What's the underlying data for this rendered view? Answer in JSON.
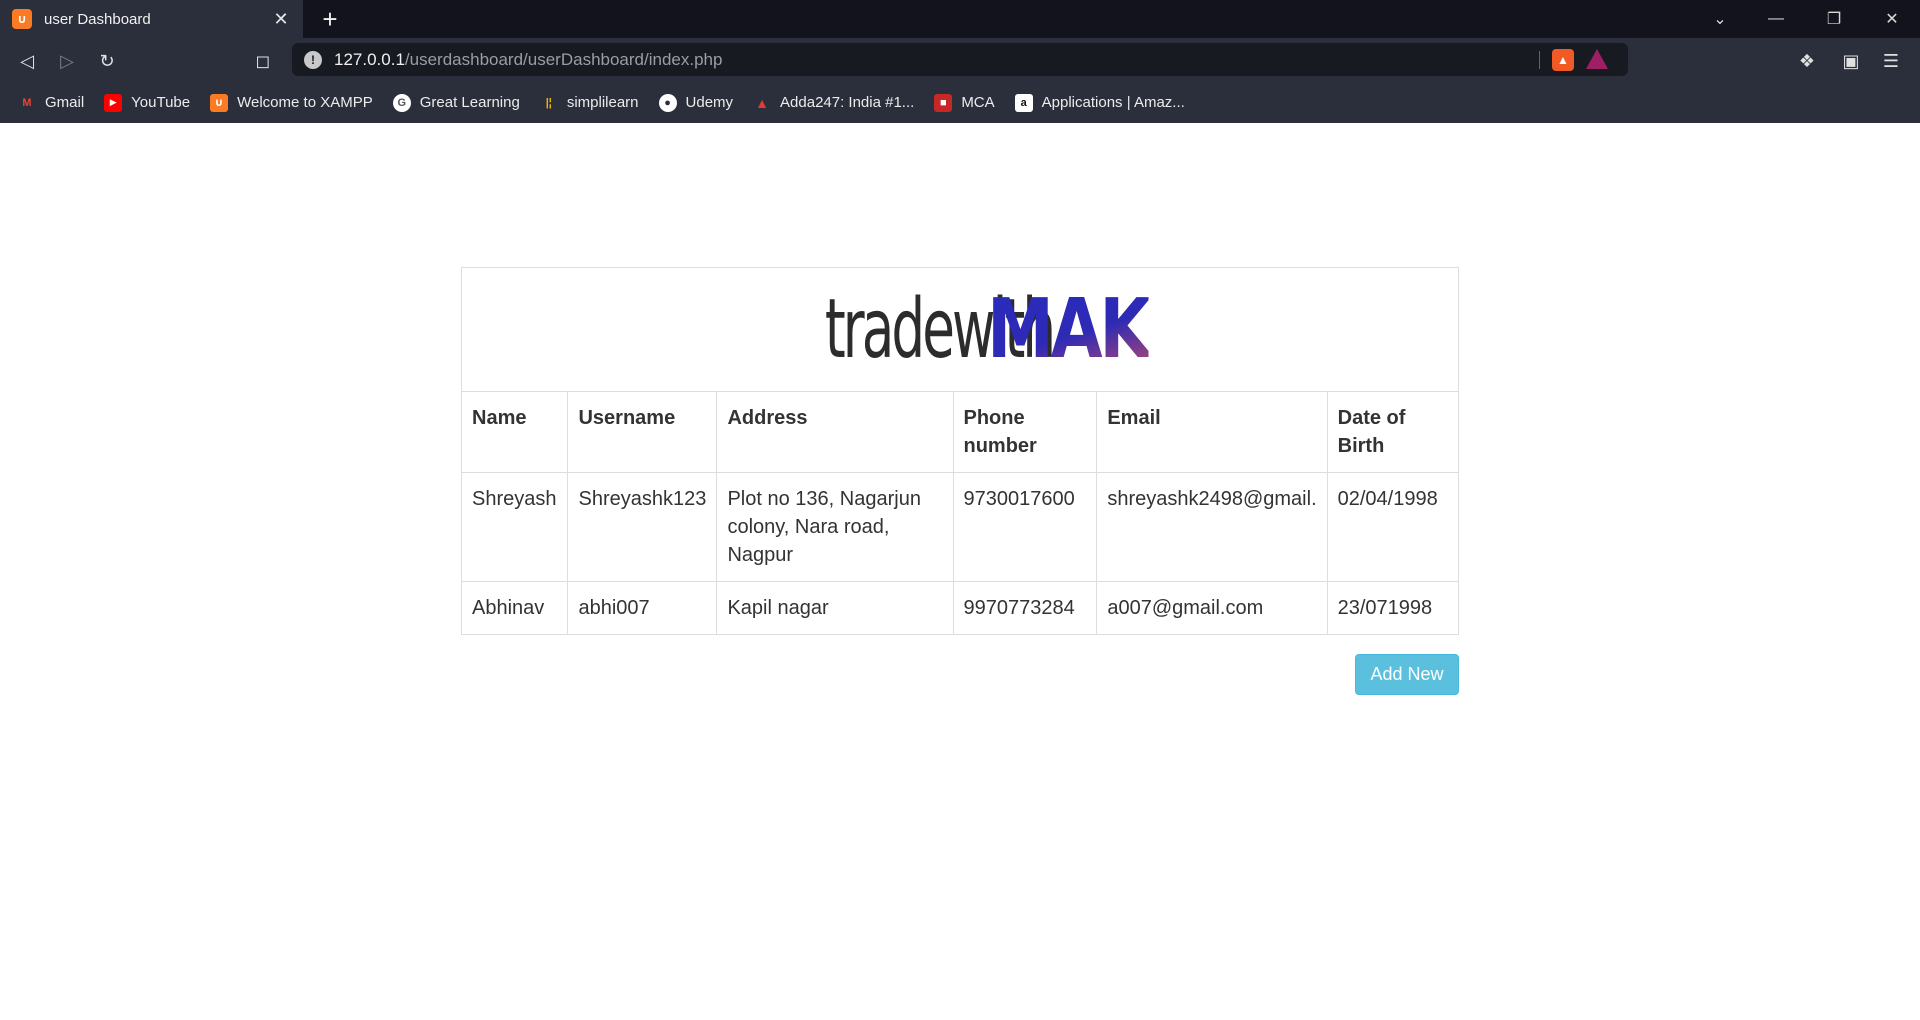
{
  "browser": {
    "tab_title": "user Dashboard",
    "tab_favicon": "xampp-icon",
    "new_tab_label": "+",
    "url_host": "127.0.0.1",
    "url_path": "/userdashboard/userDashboard/index.php",
    "window_controls": [
      "chevron-down-icon",
      "minimize-icon",
      "restore-icon",
      "close-icon"
    ]
  },
  "bookmarks": [
    {
      "label": "Gmail",
      "icon": "gmail-icon",
      "color": "#ea4335"
    },
    {
      "label": "YouTube",
      "icon": "youtube-icon",
      "color": "#ff0000"
    },
    {
      "label": "Welcome to XAMPP",
      "icon": "xampp-icon",
      "color": "#fb7a24"
    },
    {
      "label": "Great Learning",
      "icon": "google-icon",
      "color": "#ffffff"
    },
    {
      "label": "simplilearn",
      "icon": "simplilearn-icon",
      "color": "#f4b400"
    },
    {
      "label": "Udemy",
      "icon": "globe-icon",
      "color": "#ffffff"
    },
    {
      "label": "Adda247: India #1...",
      "icon": "adda-icon",
      "color": "#e53935"
    },
    {
      "label": "MCA",
      "icon": "mca-icon",
      "color": "#c62828"
    },
    {
      "label": "Applications | Amaz...",
      "icon": "amazon-icon",
      "color": "#ffffff"
    }
  ],
  "logo": {
    "part1": "tradewith",
    "part2": "MAK"
  },
  "table": {
    "headers": [
      "Name",
      "Username",
      "Address",
      "Phone number",
      "Email",
      "Date of Birth"
    ],
    "rows": [
      [
        "Shreyash",
        "Shreyashk123",
        "Plot no 136, Nagarjun colony, Nara road, Nagpur",
        "9730017600",
        "shreyashk2498@gmail.",
        "02/04/1998"
      ],
      [
        "Abhinav",
        "abhi007",
        "Kapil nagar",
        "9970773284",
        "a007@gmail.com",
        "23/071998"
      ]
    ]
  },
  "add_new_label": "Add New",
  "colors": {
    "accent": "#5bc0de",
    "logo_blue": "#2a2bbd",
    "logo_pink": "#c24a6a"
  }
}
